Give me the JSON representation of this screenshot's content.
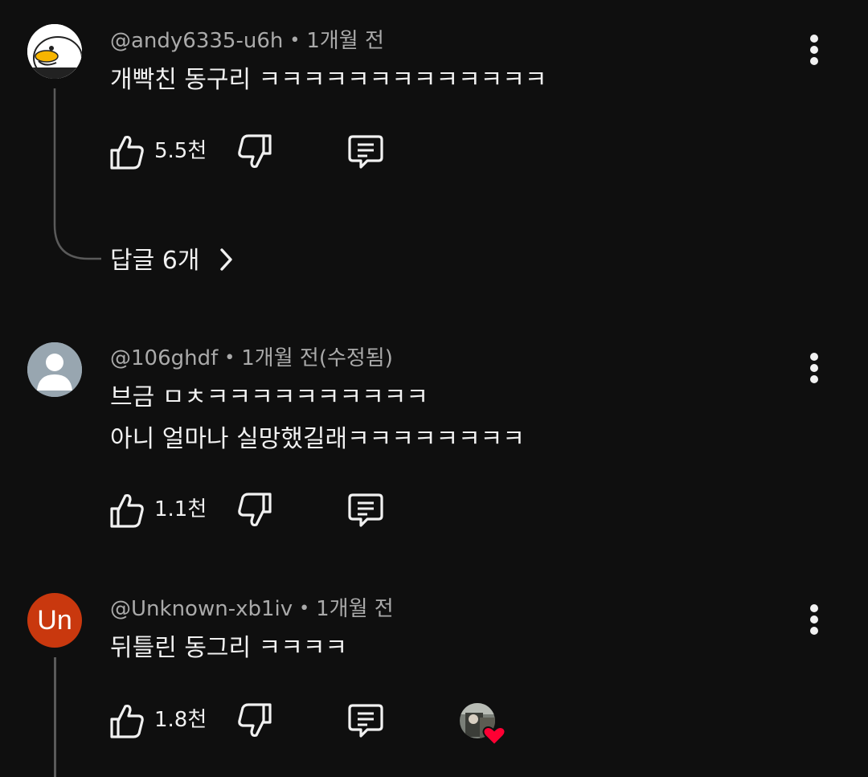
{
  "comments": [
    {
      "author": "@andy6335-u6h",
      "separator": "•",
      "time": "1개월 전",
      "lines": [
        "개빡친 동구리 ㅋㅋㅋㅋㅋㅋㅋㅋㅋㅋㅋㅋㅋ"
      ],
      "likes": "5.5천",
      "replies_label": "답글 6개",
      "avatar": "duck-avatar"
    },
    {
      "author": "@106ghdf",
      "separator": "•",
      "time": "1개월 전(수정됨)",
      "lines": [
        "브금 ㅁㅊㅋㅋㅋㅋㅋㅋㅋㅋㅋㅋ",
        "아니 얼마나 실망했길래ㅋㅋㅋㅋㅋㅋㅋㅋ"
      ],
      "likes": "1.1천",
      "avatar": "default-avatar"
    },
    {
      "author": "@Unknown-xb1iv",
      "separator": "•",
      "time": "1개월 전",
      "lines": [
        "뒤틀린 동그리 ㅋㅋㅋㅋ"
      ],
      "likes": "1.8천",
      "avatar_initials": "Un",
      "avatar_color": "#c9380e",
      "creator_heart": true
    }
  ],
  "colors": {
    "background": "#0f0f0f",
    "text": "#f1f1f1",
    "secondary_text": "#aaaaaa",
    "heart": "#ff0033"
  }
}
